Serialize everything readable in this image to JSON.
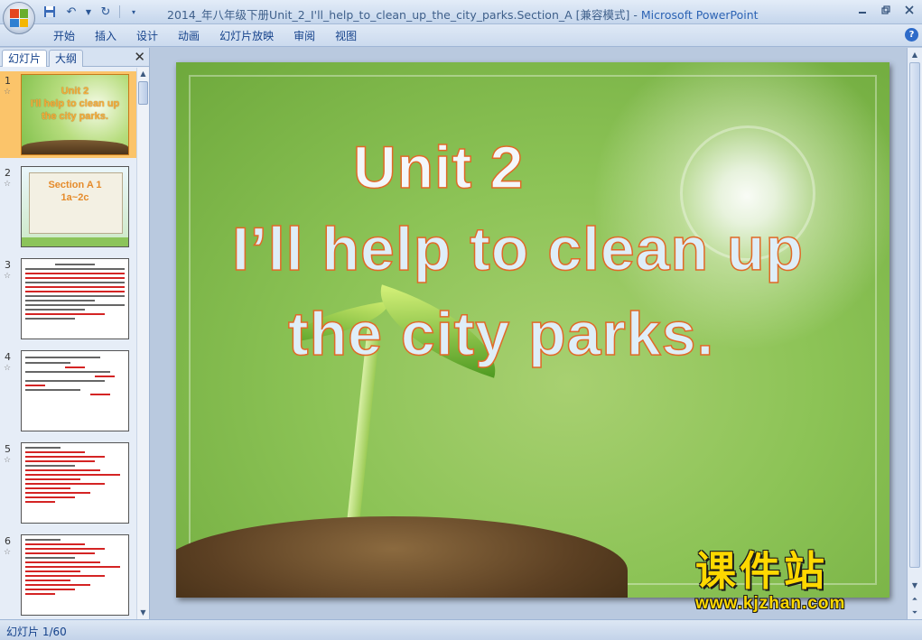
{
  "window": {
    "title": "2014_年八年级下册Unit_2_I'll_help_to_clean_up_the_city_parks.Section_A [兼容模式]",
    "separator": " - ",
    "app_name": "Microsoft PowerPoint",
    "controls": [
      "minimize",
      "restore",
      "close"
    ]
  },
  "quick_access": {
    "icons": [
      "save-icon",
      "undo-icon",
      "dropdown-icon",
      "redo-icon",
      "customize-icon"
    ]
  },
  "ribbon": {
    "tabs": [
      "开始",
      "插入",
      "设计",
      "动画",
      "幻灯片放映",
      "审阅",
      "视图"
    ]
  },
  "left_pane": {
    "tabs": [
      "幻灯片",
      "大纲"
    ],
    "active_tab": "幻灯片",
    "close_symbol": "✕",
    "slides": [
      {
        "number": "1",
        "selected": true,
        "title": [
          "Unit 2",
          "I'll help to clean up",
          "the city parks."
        ]
      },
      {
        "number": "2",
        "selected": false,
        "title": [
          "Section A 1",
          "1a~2c"
        ]
      },
      {
        "number": "3",
        "selected": false
      },
      {
        "number": "4",
        "selected": false
      },
      {
        "number": "5",
        "selected": false
      },
      {
        "number": "6",
        "selected": false
      }
    ]
  },
  "slide": {
    "title_line1": "Unit 2",
    "title_line2": "I’ll help to clean up",
    "title_line3": "the city parks."
  },
  "watermark": {
    "chinese": "课件站",
    "url": "www.kjzhan.com"
  },
  "status_bar": {
    "slide_count": "幻灯片 1/60"
  },
  "colors": {
    "selected_thumb": "#fbc46a",
    "title_stroke": "#e06a28",
    "watermark": "#ffd800",
    "app_title": "#2c63b4"
  }
}
